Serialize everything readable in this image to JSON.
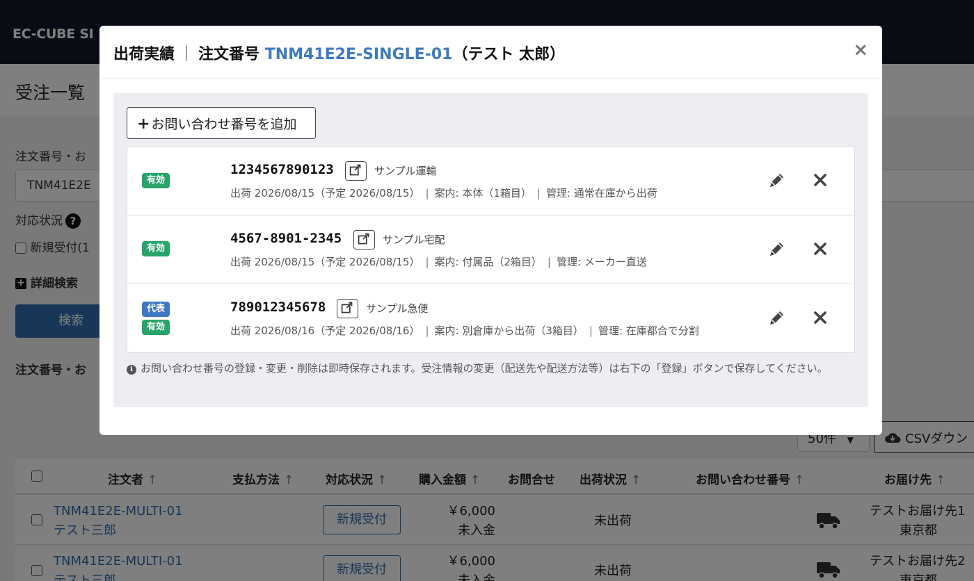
{
  "app": {
    "brand": "EC-CUBE SI"
  },
  "page": {
    "title": "受注一覧",
    "order_label": "注文番号・お",
    "search_value": "TNM41E2E",
    "status_label": "対応状況",
    "new_checkbox_label": "新規受付(1",
    "advanced_search": "詳細検索",
    "search_button": "検索",
    "result_label": "注文番号・お",
    "per_page": "50件",
    "csv_button": "CSVダウン"
  },
  "table": {
    "headers": [
      "注文者",
      "支払方法",
      "対応状況",
      "購入金額",
      "お問合せ",
      "出荷状況",
      "お問い合わせ番号",
      "お届け先"
    ],
    "rows": [
      {
        "order_no": "TNM41E2E-MULTI-01",
        "customer": "テスト三郎",
        "status": "新規受付",
        "amount": "￥6,000",
        "payment_status": "未入金",
        "shipping_status": "未出荷",
        "dest_name": "テストお届け先1",
        "dest_pref": "東京都"
      },
      {
        "order_no": "TNM41E2E-MULTI-01",
        "customer": "テスト三郎",
        "status": "新規受付",
        "amount": "￥6,000",
        "payment_status": "未入金",
        "shipping_status": "未出荷",
        "dest_name": "テストお届け先2",
        "dest_pref": "東京都"
      }
    ]
  },
  "modal": {
    "title_main": "出荷実績",
    "title_sep": "｜",
    "title_order_label": "注文番号",
    "order_no": "TNM41E2E-SINGLE-01",
    "customer_paren": "（テスト 太郎）",
    "close": "×",
    "add_button": "お問い合わせ番号を追加",
    "items": [
      {
        "badges": [
          "有効"
        ],
        "tracking": "1234567890123",
        "carrier": "サンプル運輸",
        "shipping": "出荷 2026/08/15（予定 2026/08/15）",
        "guide": "案内: 本体（1箱目）",
        "management": "管理: 通常在庫から出荷"
      },
      {
        "badges": [
          "有効"
        ],
        "tracking": "4567-8901-2345",
        "carrier": "サンプル宅配",
        "shipping": "出荷 2026/08/15（予定 2026/08/15）",
        "guide": "案内: 付属品（2箱目）",
        "management": "管理: メーカー直送"
      },
      {
        "badges": [
          "代表",
          "有効"
        ],
        "tracking": "789012345678",
        "carrier": "サンプル急便",
        "shipping": "出荷 2026/08/16（予定 2026/08/16）",
        "guide": "案内: 別倉庫から出荷（3箱目）",
        "management": "管理: 在庫都合で分割"
      }
    ],
    "note": "お問い合わせ番号の登録・変更・削除は即時保存されます。受注情報の変更（配送先や配送方法等）は右下の「登録」ボタンで保存してください。"
  },
  "colors": {
    "topbar": "#101a2b",
    "primary": "#2f6db0",
    "badge_green": "#28a46a",
    "badge_blue": "#3e78c2"
  },
  "icons": [
    "help-icon",
    "plus-icon",
    "cloud-download-icon",
    "truck-icon",
    "external-link-icon",
    "pencil-icon",
    "close-icon",
    "info-icon"
  ]
}
